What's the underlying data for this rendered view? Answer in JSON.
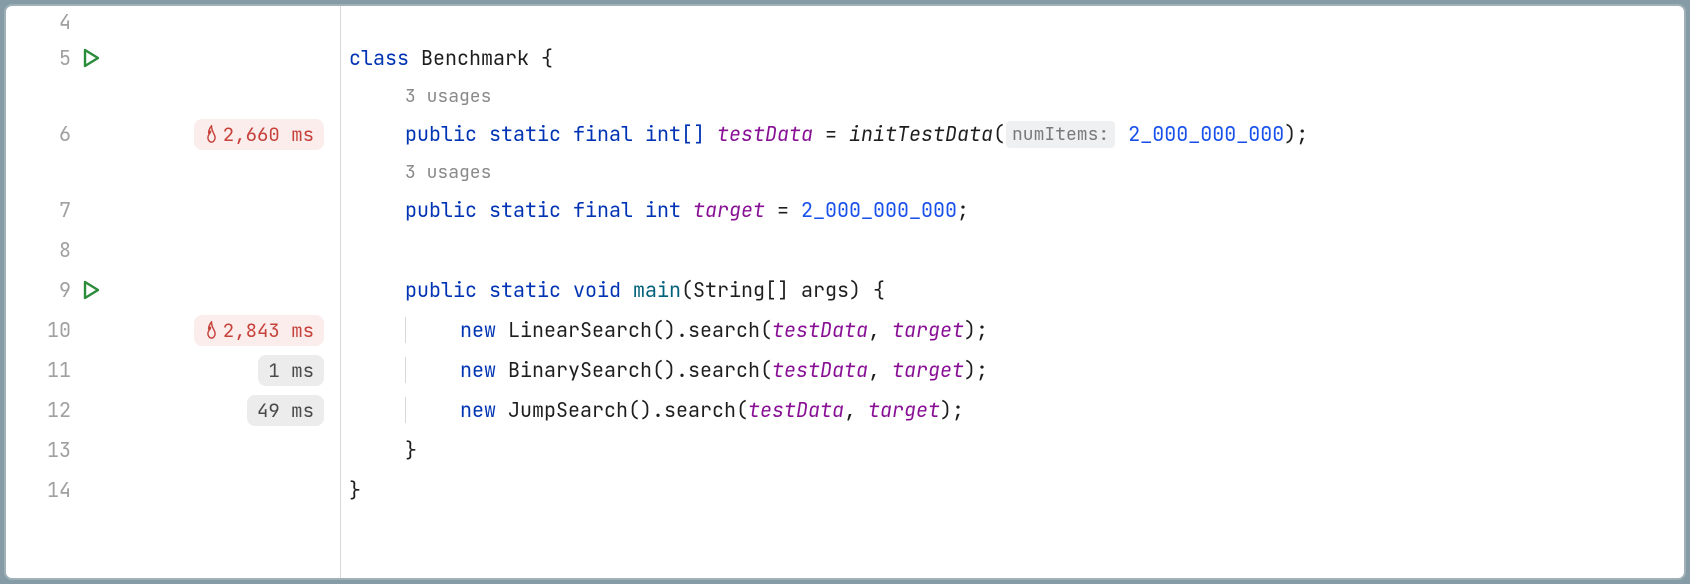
{
  "hints": {
    "usages_a": "3 usages",
    "usages_b": "3 usages"
  },
  "gutter": {
    "lines": [
      "4",
      "5",
      "6",
      "7",
      "8",
      "9",
      "10",
      "11",
      "12",
      "13",
      "14"
    ],
    "timings": {
      "l6": "2,660 ms",
      "l10": "2,843 ms",
      "l11": "1 ms",
      "l12": "49 ms"
    }
  },
  "code": {
    "kw_class": "class",
    "class_name": "Benchmark",
    "brace_open": " {",
    "kw_public": "public",
    "kw_static": "static",
    "kw_final": "final",
    "kw_void": "void",
    "kw_new": "new",
    "type_int_arr": "int[]",
    "type_int": "int",
    "type_string_arr": "String[]",
    "field_testData": "testData",
    "field_target": "target",
    "eq": " = ",
    "call_initTestData": "initTestData",
    "paren_open": "(",
    "paren_close": ")",
    "paren_close_semi": ");",
    "param_hint": "numItems:",
    "num_2b": "2_000_000_000",
    "semi": ";",
    "method_main": "main",
    "args": "args",
    "brace_open2": " {",
    "brace_close": "}",
    "cls_LinearSearch": "LinearSearch",
    "cls_BinarySearch": "BinarySearch",
    "cls_JumpSearch": "JumpSearch",
    "ctor_search": "().search(",
    "comma": ", "
  }
}
